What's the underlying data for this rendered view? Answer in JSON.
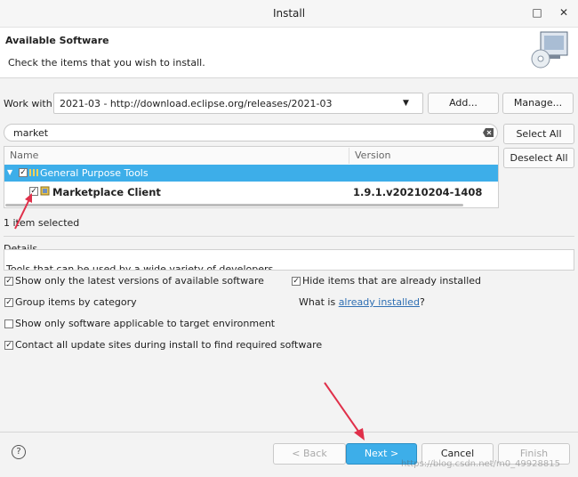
{
  "window": {
    "title": "Install"
  },
  "banner": {
    "title": "Available Software",
    "description": "Check the items that you wish to install."
  },
  "work_with": {
    "label": "Work with:",
    "value": "2021-03 - http://download.eclipse.org/releases/2021-03",
    "add_label": "Add...",
    "manage_label": "Manage..."
  },
  "filter": {
    "value": "market"
  },
  "table": {
    "col_name": "Name",
    "col_version": "Version",
    "category": "General Purpose Tools",
    "item_name": "Marketplace Client",
    "item_version": "1.9.1.v20210204-1408"
  },
  "select_all_label": "Select All",
  "deselect_all_label": "Deselect All",
  "status": "1 item selected",
  "details": {
    "label": "Details",
    "text": "Tools that can be used by a wide variety of developers"
  },
  "options": {
    "latest": "Show only the latest versions of available software",
    "group": "Group items by category",
    "target_env": "Show only software applicable to target environment",
    "contact_sites": "Contact all update sites during install to find required software",
    "hide_installed": "Hide items that are already installed",
    "what_is": "What is ",
    "already_installed": "already installed",
    "question_mark": "?"
  },
  "buttons": {
    "back": "< Back",
    "next": "Next >",
    "cancel": "Cancel",
    "finish": "Finish"
  },
  "watermark": "https://blog.csdn.net/m0_49928815",
  "colors": {
    "selection": "#3daee9",
    "link": "#2f6fb3",
    "arrow": "#e0304a"
  }
}
